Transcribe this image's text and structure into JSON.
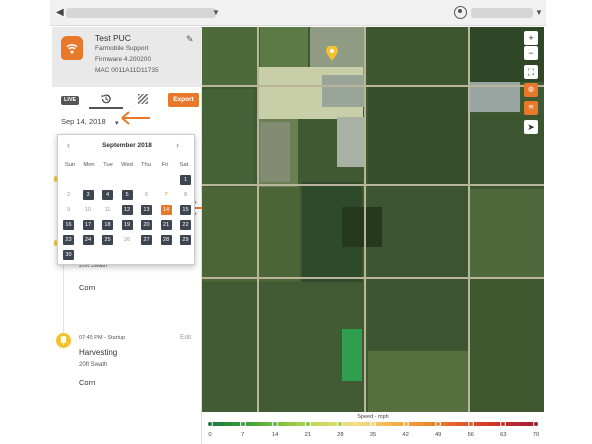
{
  "app": {
    "back_icon": "chevron-left-icon",
    "account_icon": "account-circle-icon"
  },
  "device": {
    "name": "Test PUC",
    "line1": "Farmobile Support",
    "line2": "Firmware 4.200200",
    "line3": "MAC 0011A11D11735",
    "icon": "wifi-device-icon",
    "edit_icon": "pencil-icon"
  },
  "tabs": {
    "live": "LIVE",
    "history_icon": "history-icon",
    "swath_icon": "swath-icon",
    "export": "Export"
  },
  "date": {
    "value": "Sep 14, 2018",
    "caret": "▾"
  },
  "calendar": {
    "month": "September 2018",
    "prev": "‹",
    "next": "›",
    "weekdays": [
      "Sun",
      "Mon",
      "Tue",
      "Wed",
      "Thu",
      "Fri",
      "Sat"
    ],
    "weeks": [
      [
        null,
        null,
        null,
        null,
        null,
        null,
        "1"
      ],
      [
        "2",
        "3",
        "4",
        "5",
        "6",
        "7",
        "8"
      ],
      [
        "9",
        "10",
        "11",
        "12",
        "13",
        "14",
        "15"
      ],
      [
        "16",
        "17",
        "18",
        "19",
        "20",
        "21",
        "22"
      ],
      [
        "23",
        "24",
        "25",
        "26",
        "27",
        "28",
        "29"
      ],
      [
        "30",
        null,
        null,
        null,
        null,
        null,
        null
      ]
    ],
    "days_with_data": [
      "1",
      "3",
      "4",
      "5",
      "12",
      "13",
      "15",
      "16",
      "17",
      "18",
      "19",
      "20",
      "21",
      "22",
      "23",
      "24",
      "25",
      "27",
      "28",
      "29",
      "30"
    ],
    "selected": "14",
    "today": "7"
  },
  "timeline": {
    "event1": {
      "swath": "20ft Swath",
      "crop": "Corn"
    },
    "event2": {
      "time": "07:45 PM - Startup",
      "edit": "Edit",
      "title": "Harvesting",
      "swath": "20ft Swath",
      "crop": "Corn",
      "icon": "wheat-icon"
    }
  },
  "map": {
    "controls": {
      "zoom_in": "+",
      "zoom_out": "−",
      "fullscreen_icon": "fullscreen-icon",
      "layers_icon": "globe-icon",
      "stack_icon": "layers-icon",
      "locate_icon": "navigation-arrow-icon"
    },
    "pin_icon": "wheat-marker-icon"
  },
  "legend": {
    "title": "Speed - mph",
    "ticks": [
      "0",
      "7",
      "14",
      "21",
      "28",
      "35",
      "42",
      "49",
      "56",
      "63",
      "70"
    ],
    "colors": [
      "#1b7a3e",
      "#3f9c3e",
      "#5fb143",
      "#82c341",
      "#a9cf4b",
      "#e8dc7a",
      "#f5b34a",
      "#ec8a2e",
      "#e05a2a",
      "#c9302c",
      "#a31d36"
    ]
  },
  "colors": {
    "accent": "#e8792b",
    "dark_day": "#3c4550"
  }
}
